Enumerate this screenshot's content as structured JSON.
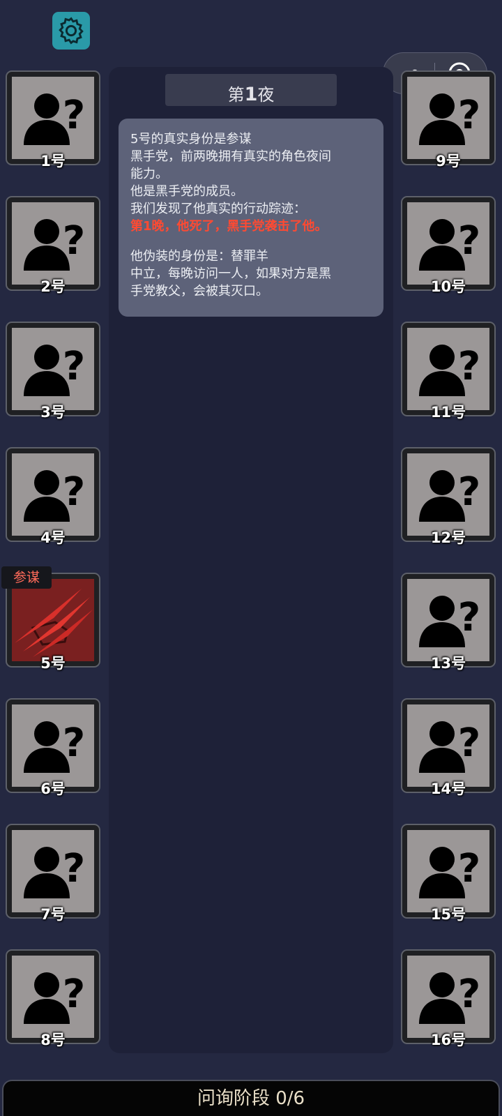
{
  "night_title": {
    "prefix": "第",
    "number": "1",
    "suffix": "夜"
  },
  "message": {
    "lines": [
      "5号的真实身份是参谋",
      "黑手党，前两晚拥有真实的角色夜间",
      "能力。",
      "他是黑手党的成员。",
      "我们发现了他真实的行动踪迹："
    ],
    "highlight": "第1晚，他死了，黑手党袭击了他。",
    "disguise_lines": [
      "他伪装的身份是：替罪羊",
      "中立，每晚访问一人，如果对方是黑",
      "手党教父，会被其灭口。"
    ],
    "highlight_color": "#ff4a32"
  },
  "players": [
    {
      "label": "1号",
      "status": "unknown"
    },
    {
      "label": "2号",
      "status": "unknown"
    },
    {
      "label": "3号",
      "status": "unknown"
    },
    {
      "label": "4号",
      "status": "unknown"
    },
    {
      "label": "5号",
      "status": "dead"
    },
    {
      "label": "6号",
      "status": "unknown"
    },
    {
      "label": "7号",
      "status": "unknown"
    },
    {
      "label": "8号",
      "status": "unknown"
    },
    {
      "label": "9号",
      "status": "unknown"
    },
    {
      "label": "10号",
      "status": "unknown"
    },
    {
      "label": "11号",
      "status": "unknown"
    },
    {
      "label": "12号",
      "status": "unknown"
    },
    {
      "label": "13号",
      "status": "unknown"
    },
    {
      "label": "14号",
      "status": "unknown"
    },
    {
      "label": "15号",
      "status": "unknown"
    },
    {
      "label": "16号",
      "status": "unknown"
    }
  ],
  "revealed_role": "参谋",
  "phase": "问询阶段 0/6",
  "icons": {
    "settings": "gear-icon",
    "more": "more-dots-icon",
    "close": "target-close-icon",
    "unknown": "unknown-user-icon",
    "dead": "claw-scratch-icon"
  },
  "colors": {
    "background": "#242841",
    "accent": "#2a9aa8",
    "dead": "#7a2020"
  }
}
